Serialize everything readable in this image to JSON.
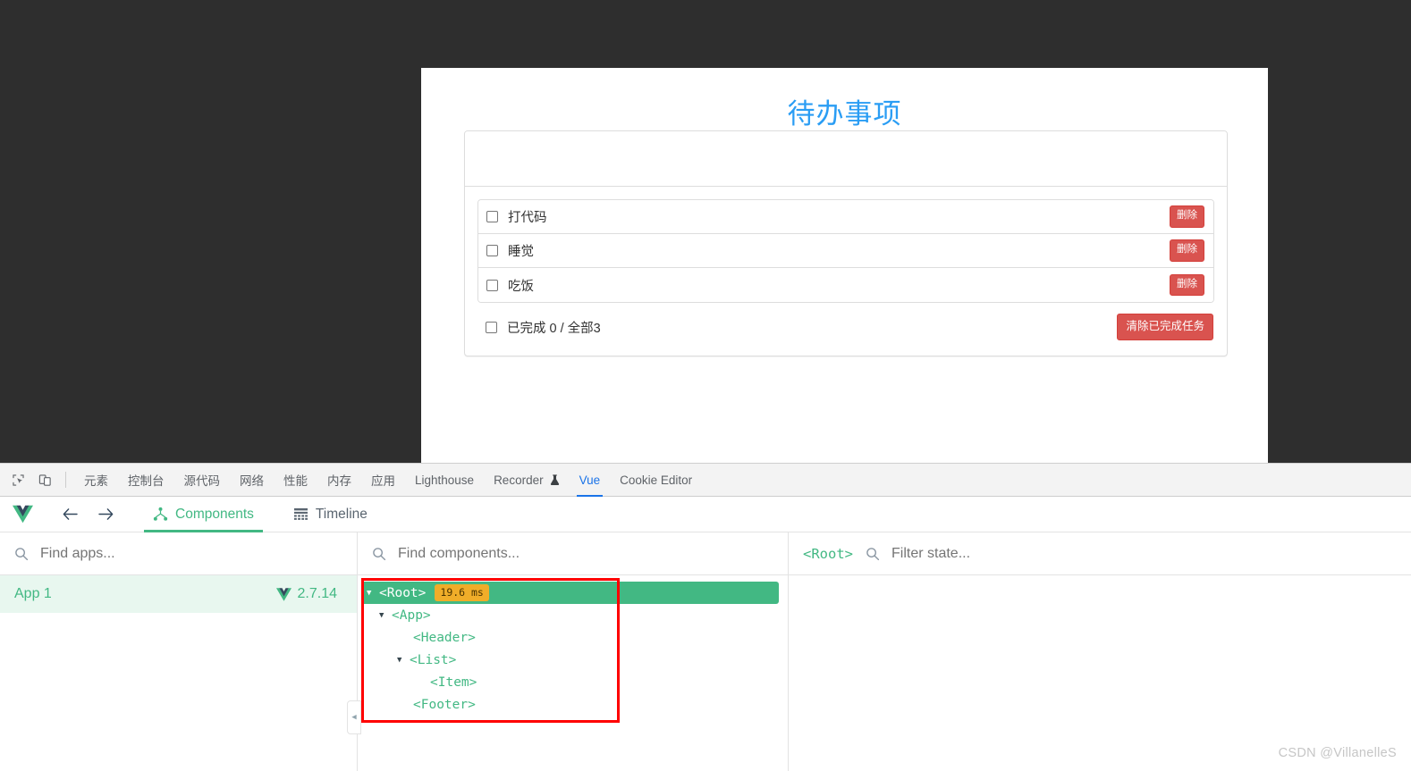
{
  "app": {
    "title": "待办事项",
    "todos": [
      {
        "label": "打代码",
        "delete_label": "删除",
        "checked": false
      },
      {
        "label": "睡觉",
        "delete_label": "删除",
        "checked": false
      },
      {
        "label": "吃饭",
        "delete_label": "删除",
        "checked": false
      }
    ],
    "footer": {
      "summary": "已完成 0 / 全部3",
      "clear_label": "清除已完成任务",
      "checked": false
    },
    "input_placeholder": ""
  },
  "devtools": {
    "left_icons": [
      {
        "name": "inspect-element-icon"
      },
      {
        "name": "device-toolbar-icon"
      }
    ],
    "tabs": [
      {
        "label": "元素",
        "active": false
      },
      {
        "label": "控制台",
        "active": false
      },
      {
        "label": "源代码",
        "active": false
      },
      {
        "label": "网络",
        "active": false
      },
      {
        "label": "性能",
        "active": false
      },
      {
        "label": "内存",
        "active": false
      },
      {
        "label": "应用",
        "active": false
      },
      {
        "label": "Lighthouse",
        "active": false
      },
      {
        "label": "Recorder",
        "active": false,
        "icon": "flask-icon"
      },
      {
        "label": "Vue",
        "active": true
      },
      {
        "label": "Cookie Editor",
        "active": false
      }
    ],
    "active_tab_color": "#1a73e8"
  },
  "vue": {
    "brand_color": "#42b883",
    "toolbar": {
      "back_label": "←",
      "forward_label": "→",
      "tabs": [
        {
          "label": "Components",
          "active": true,
          "icon": "component-tree-icon"
        },
        {
          "label": "Timeline",
          "active": false,
          "icon": "timeline-grid-icon"
        }
      ]
    },
    "apps_panel": {
      "search_placeholder": "Find apps...",
      "items": [
        {
          "name": "App 1",
          "version": "2.7.14"
        }
      ]
    },
    "components_panel": {
      "search_placeholder": "Find components...",
      "tree": [
        {
          "name": "<Root>",
          "depth": 0,
          "expandable": true,
          "selected": true,
          "badge": "19.6 ms"
        },
        {
          "name": "<App>",
          "depth": 1,
          "expandable": true,
          "selected": false,
          "badge": ""
        },
        {
          "name": "<Header>",
          "depth": 2,
          "expandable": false,
          "selected": false,
          "badge": ""
        },
        {
          "name": "<List>",
          "depth": 2,
          "expandable": true,
          "selected": false,
          "badge": ""
        },
        {
          "name": "<Item>",
          "depth": 3,
          "expandable": false,
          "selected": false,
          "badge": ""
        },
        {
          "name": "<Footer>",
          "depth": 2,
          "expandable": false,
          "selected": false,
          "badge": ""
        }
      ],
      "highlight_box_color": "#ff0000"
    },
    "state_panel": {
      "selected_component": "<Root>",
      "filter_placeholder": "Filter state..."
    }
  },
  "watermark": "CSDN @VillanelleS"
}
